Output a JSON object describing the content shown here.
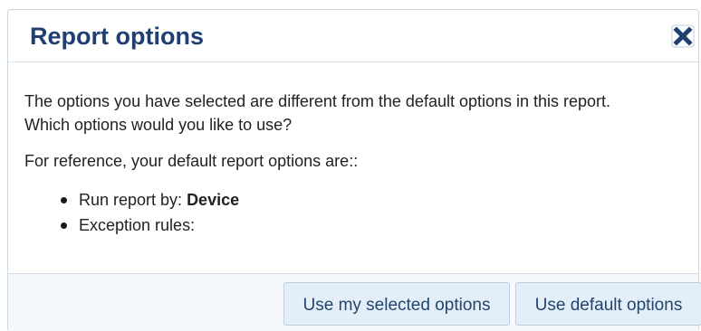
{
  "dialog": {
    "title": "Report options",
    "close_icon": "close-icon",
    "body": {
      "line1": "The options you have selected are different from the default options in this report.",
      "line2": "Which options would you like to use?",
      "reference": "For reference, your default report options are::",
      "items": [
        {
          "label": "Run report by: ",
          "value": "Device"
        },
        {
          "label": "Exception rules:",
          "value": ""
        }
      ]
    },
    "buttons": {
      "use_selected": "Use my selected options",
      "use_default": "Use default options"
    }
  },
  "colors": {
    "title": "#1f3f73",
    "button_bg": "#e3eef8",
    "button_text": "#24456e",
    "close_icon": "#1f3f73"
  }
}
